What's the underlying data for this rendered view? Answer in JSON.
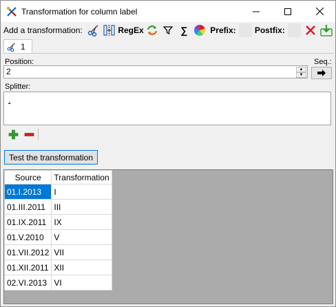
{
  "window": {
    "title": "Transformation for column label",
    "minimize_glyph": "—",
    "maximize_glyph": "☐",
    "close_glyph": "✕"
  },
  "toolbar": {
    "label": "Add a transformation:",
    "items": [
      {
        "name": "cut-icon",
        "kind": "icon"
      },
      {
        "name": "split-icon",
        "kind": "icon"
      },
      {
        "name": "regex-button",
        "kind": "text",
        "text": "RegEx"
      },
      {
        "name": "replace-icon",
        "kind": "icon"
      },
      {
        "name": "filter-icon",
        "kind": "icon"
      },
      {
        "name": "sum-icon",
        "kind": "icon"
      },
      {
        "name": "color-icon",
        "kind": "icon"
      }
    ],
    "prefix_label": "Prefix:",
    "postfix_label": "Postfix:",
    "regex_label": "RegEx",
    "sum_glyph": "∑",
    "filter_glyph": "▼"
  },
  "tab": {
    "label": "1"
  },
  "position": {
    "label": "Position:",
    "value": "2",
    "seq_label": "Seq.:"
  },
  "splitter": {
    "label": "Splitter:",
    "value": "."
  },
  "test_button": {
    "label": "Test the transformation"
  },
  "grid": {
    "columns": [
      "Source",
      "Transformation"
    ],
    "rows": [
      [
        "01.I.2013",
        "I"
      ],
      [
        "01.III.2011",
        "III"
      ],
      [
        "01.IX.2011",
        "IX"
      ],
      [
        "01.V.2010",
        "V"
      ],
      [
        "01.VII.2012",
        "VII"
      ],
      [
        "01.XII.2011",
        "XII"
      ],
      [
        "02.VI.2013",
        "VI"
      ]
    ],
    "selected_row": 0
  },
  "colors": {
    "selection": "#0078d7",
    "grid_background": "#ababab",
    "add_green": "#2e9e2e",
    "remove_red": "#d42020"
  }
}
